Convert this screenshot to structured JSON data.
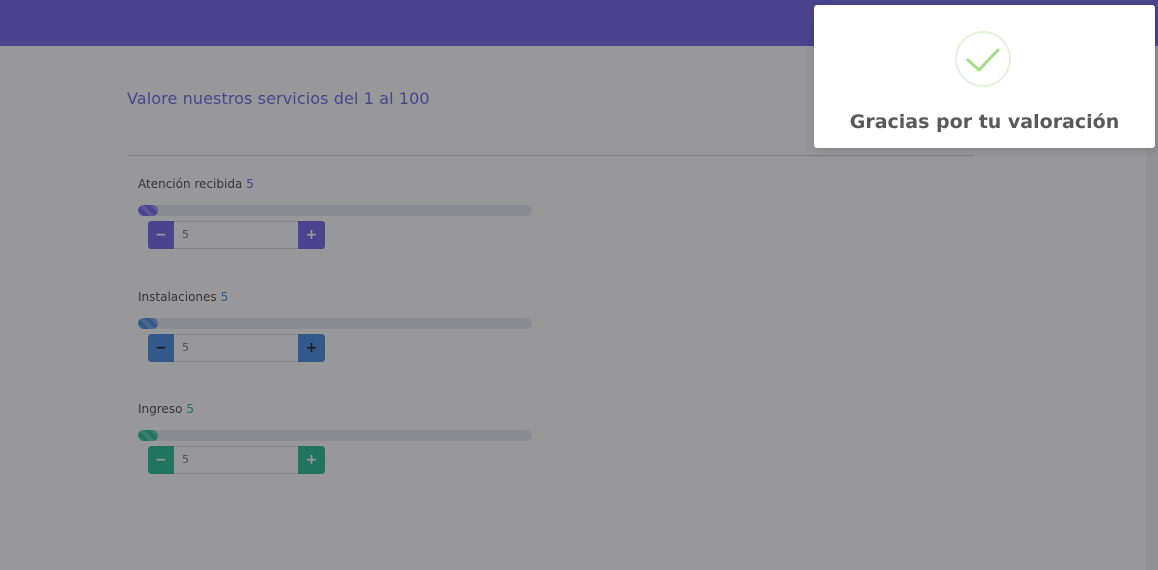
{
  "colors": {
    "topbar": "#6b5ce7",
    "heading": "#6b5ce7",
    "atencion": "#6b5ce7",
    "instalaciones": "#3f86e0",
    "ingreso": "#1bbc8b",
    "success": "#a5dc86"
  },
  "page": {
    "heading": "Valore nuestros servicios del 1 al 100"
  },
  "ratings": [
    {
      "label": "Atención recibida",
      "value": "5",
      "input_value": "5",
      "percent": 5,
      "minus_icon": "minus-icon",
      "plus_icon": "plus-icon"
    },
    {
      "label": "Instalaciones",
      "value": "5",
      "input_value": "5",
      "percent": 5,
      "minus_icon": "minus-icon",
      "plus_icon": "plus-icon"
    },
    {
      "label": "Ingreso",
      "value": "5",
      "input_value": "5",
      "percent": 5,
      "minus_icon": "minus-icon",
      "plus_icon": "plus-icon"
    }
  ],
  "toast": {
    "icon": "check-icon",
    "title": "Gracias por tu valoración"
  }
}
